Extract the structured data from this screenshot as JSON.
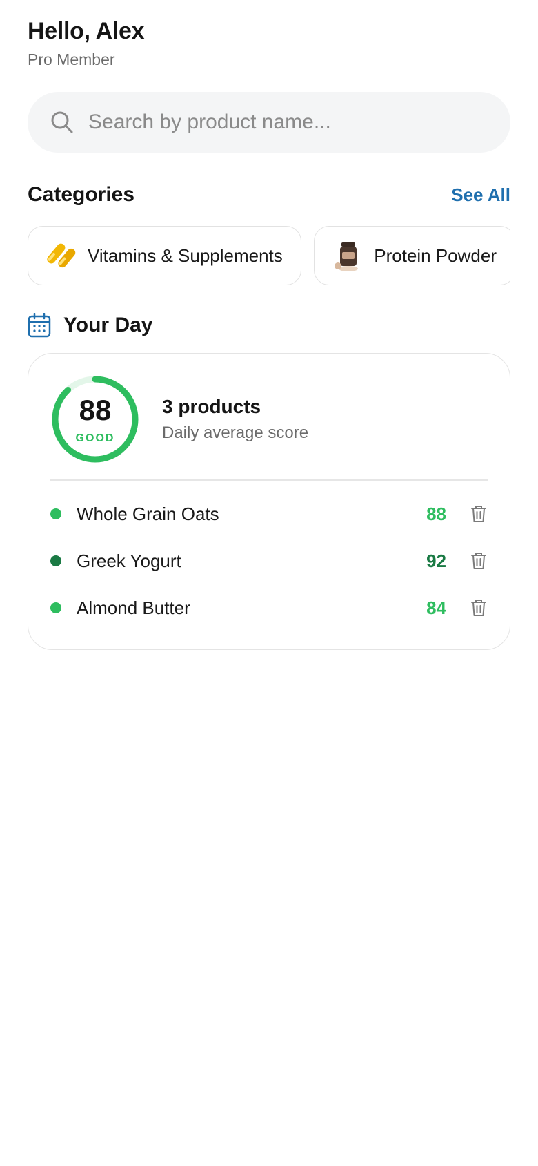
{
  "header": {
    "greeting": "Hello, Alex",
    "membership": "Pro Member"
  },
  "search": {
    "placeholder": "Search by product name...",
    "value": "",
    "icon": "search-icon"
  },
  "categories": {
    "title": "Categories",
    "see_all_label": "See All",
    "items": [
      {
        "label": "Vitamins & Supplements",
        "icon": "vitamin-capsules-icon"
      },
      {
        "label": "Protein Powder",
        "icon": "protein-powder-jar-icon"
      }
    ]
  },
  "your_day": {
    "title": "Your Day",
    "icon": "calendar-icon",
    "score": "88",
    "score_fraction": 0.88,
    "grade": "GOOD",
    "products_count": "3 products",
    "subtitle": "Daily average score",
    "items": [
      {
        "name": "Whole Grain Oats",
        "score": "88",
        "color": "#2ebd5f"
      },
      {
        "name": "Greek Yogurt",
        "score": "92",
        "color": "#1a7a44"
      },
      {
        "name": "Almond Butter",
        "score": "84",
        "color": "#2ebd5f"
      }
    ]
  },
  "colors": {
    "accent_link": "#1f6fae",
    "good_green": "#2ebd5f",
    "excellent_green": "#1a7a44",
    "ring_track": "#e3f6e9"
  }
}
